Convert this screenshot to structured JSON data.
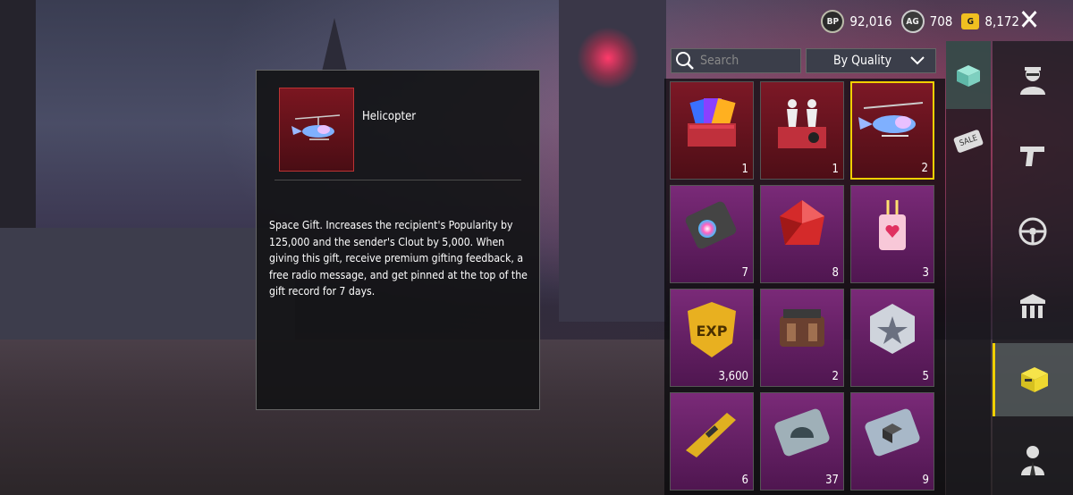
{
  "currency": {
    "bp": {
      "icon": "bp-coin-icon",
      "value": "92,016"
    },
    "ag": {
      "icon": "ag-coin-icon",
      "value": "708"
    },
    "g": {
      "icon": "g-coin-icon",
      "value": "8,172"
    }
  },
  "coin_labels": {
    "bp": "BP",
    "ag": "AG",
    "g": "G"
  },
  "detail": {
    "name": "Helicopter",
    "description": "Space Gift. Increases the recipient's Popularity by 125,000 and the sender's Clout by 5,000. When giving this gift, receive premium gifting feedback, a free radio message, and get pinned at the top of the gift record for 7 days."
  },
  "search": {
    "placeholder": "Search"
  },
  "sort": {
    "label": "By Quality"
  },
  "items": [
    {
      "name": "card-pack",
      "qty": "1",
      "rarity": "red"
    },
    {
      "name": "emote-crate",
      "qty": "1",
      "rarity": "red"
    },
    {
      "name": "helicopter",
      "qty": "2",
      "rarity": "red",
      "selected": true
    },
    {
      "name": "color-chip",
      "qty": "7",
      "rarity": "purple"
    },
    {
      "name": "red-crystal",
      "qty": "8",
      "rarity": "purple"
    },
    {
      "name": "heart-cup",
      "qty": "3",
      "rarity": "purple"
    },
    {
      "name": "exp-badge",
      "qty": "3,600",
      "rarity": "purple"
    },
    {
      "name": "engine",
      "qty": "2",
      "rarity": "purple"
    },
    {
      "name": "silver-star",
      "qty": "5",
      "rarity": "purple"
    },
    {
      "name": "gold-gun-part",
      "qty": "6",
      "rarity": "purple"
    },
    {
      "name": "helmet-ticket",
      "qty": "37",
      "rarity": "purple"
    },
    {
      "name": "cube-ticket",
      "qty": "9",
      "rarity": "purple"
    }
  ],
  "side_label": "SALE",
  "colors": {
    "selected_border": "#f2d000",
    "red_card": "#7c1826",
    "purple_card": "#7a2a78"
  }
}
